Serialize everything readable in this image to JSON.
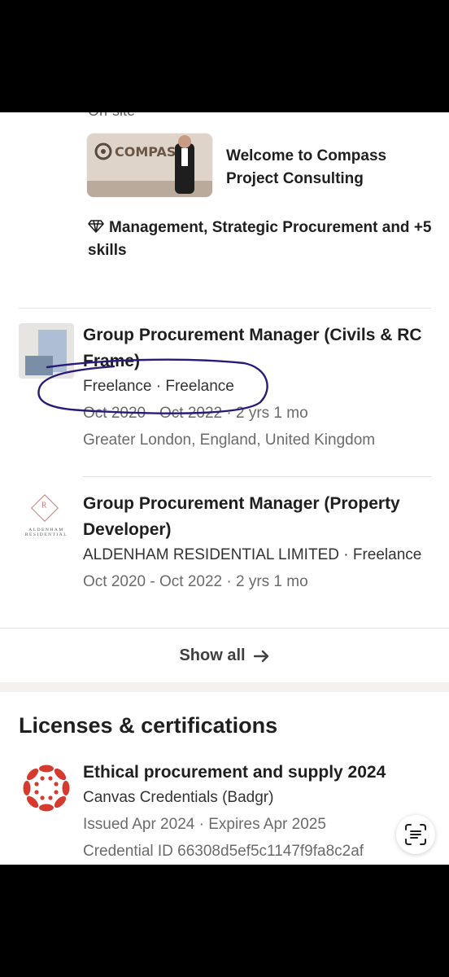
{
  "top": {
    "partial_line": "On-site",
    "media_title": "Welcome to Compass Project Consulting",
    "media_image_text": "COMPASS",
    "skills": "Management, Strategic Procurement and +5 skills"
  },
  "experience": [
    {
      "title": "Group Procurement Manager (Civils & RC Frame)",
      "subtitle": "Freelance · Freelance",
      "dates": "Oct 2020 - Oct 2022 · 2 yrs 1 mo",
      "location": "Greater London, England, United Kingdom",
      "logo": "placeholder-company-logo"
    },
    {
      "title": "Group Procurement Manager (Property Developer)",
      "subtitle": "ALDENHAM RESIDENTIAL LIMITED · Freelance",
      "dates": "Oct 2020 - Oct 2022 · 2 yrs 1 mo",
      "logo_text": "ALDENHAM RESIDENTIAL",
      "logo_letter": "R"
    }
  ],
  "show_all_label": "Show all",
  "licenses": {
    "section_title": "Licenses & certifications",
    "items": [
      {
        "title": "Ethical procurement and supply 2024",
        "issuer": "Canvas Credentials (Badgr)",
        "dates": "Issued Apr 2024 · Expires Apr 2025",
        "credential_id": "Credential ID 66308d5ef5c1147f9fa8c2af"
      }
    ]
  },
  "colors": {
    "canvas_red": "#d63a2f",
    "annotation_ink": "#2a1a7a"
  }
}
